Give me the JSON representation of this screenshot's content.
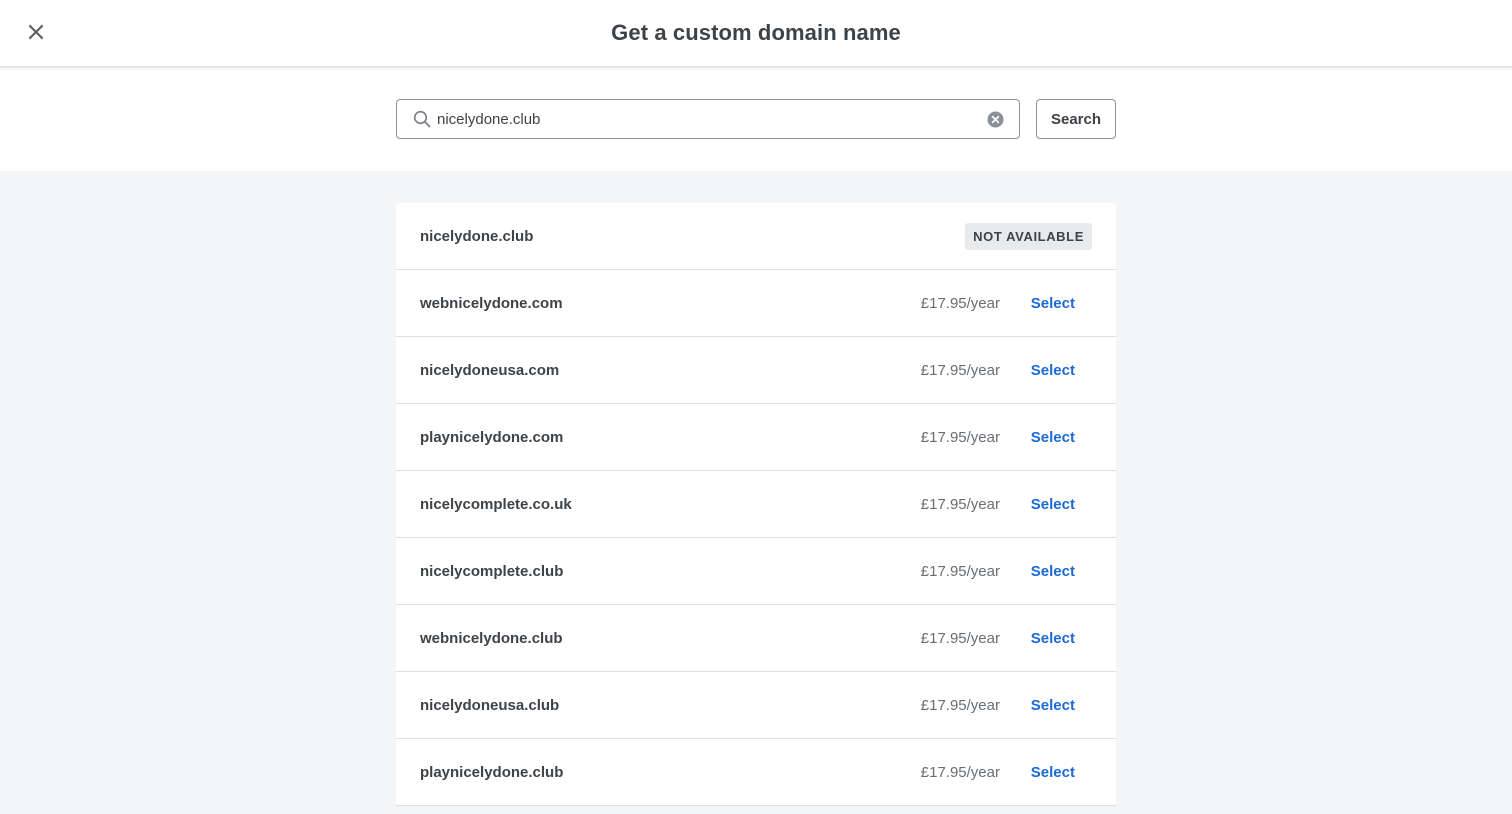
{
  "header": {
    "title": "Get a custom domain name",
    "close_icon": "close-icon"
  },
  "search": {
    "value": "nicelydone.club",
    "placeholder": "",
    "button_label": "Search",
    "search_icon": "search-icon",
    "clear_icon": "clear-icon"
  },
  "results": {
    "unavailable": {
      "domain": "nicelydone.club",
      "status": "NOT AVAILABLE"
    },
    "items": [
      {
        "domain": "webnicelydone.com",
        "price": "£17.95/year",
        "action": "Select"
      },
      {
        "domain": "nicelydoneusa.com",
        "price": "£17.95/year",
        "action": "Select"
      },
      {
        "domain": "playnicelydone.com",
        "price": "£17.95/year",
        "action": "Select"
      },
      {
        "domain": "nicelycomplete.co.uk",
        "price": "£17.95/year",
        "action": "Select"
      },
      {
        "domain": "nicelycomplete.club",
        "price": "£17.95/year",
        "action": "Select"
      },
      {
        "domain": "webnicelydone.club",
        "price": "£17.95/year",
        "action": "Select"
      },
      {
        "domain": "nicelydoneusa.club",
        "price": "£17.95/year",
        "action": "Select"
      },
      {
        "domain": "playnicelydone.club",
        "price": "£17.95/year",
        "action": "Select"
      }
    ]
  },
  "colors": {
    "link": "#1b6ad6",
    "text": "#3e4348",
    "muted": "#686e73",
    "background": "#f4f5f6",
    "badge_bg": "#e8eaec"
  }
}
